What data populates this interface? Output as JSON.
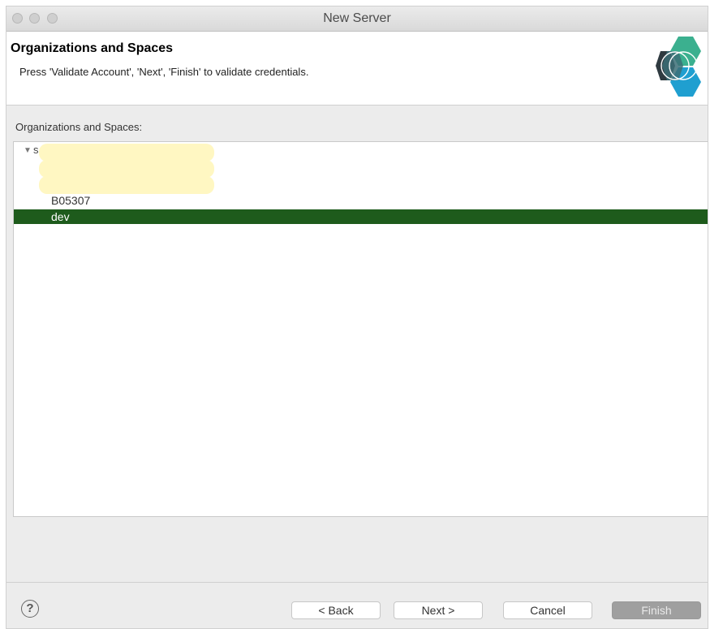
{
  "window": {
    "title": "New Server"
  },
  "header": {
    "title": "Organizations and Spaces",
    "description": "Press 'Validate Account', 'Next', 'Finish' to validate credentials."
  },
  "section": {
    "label": "Organizations and Spaces:"
  },
  "tree": {
    "root_label_visible": "s",
    "spaces": [
      {
        "label": "B05307",
        "selected": false
      },
      {
        "label": "dev",
        "selected": true
      }
    ],
    "selection_color": "#1e5b1c"
  },
  "buttons": {
    "help": "?",
    "back": "< Back",
    "next": "Next >",
    "cancel": "Cancel",
    "finish": "Finish"
  }
}
